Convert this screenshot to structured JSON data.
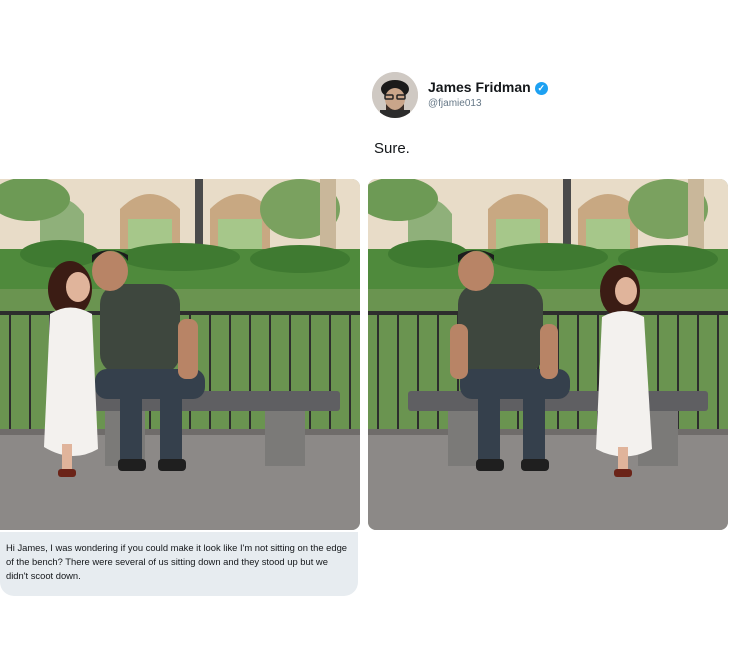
{
  "tweet": {
    "author_name": "James Fridman",
    "author_handle": "@fjamie013",
    "reply_text": "Sure.",
    "verified_icon": "verified-badge-icon",
    "accent_color": "#1da1f2"
  },
  "request": {
    "message": "Hi James, I was wondering if you could make it look like I'm not sitting on the edge of the bench? There were several of us sitting down and they stood up but we didn't scoot down."
  },
  "photos": {
    "original": "original-photo-couple-on-bench",
    "edited": "edited-photo-separated-on-bench"
  }
}
